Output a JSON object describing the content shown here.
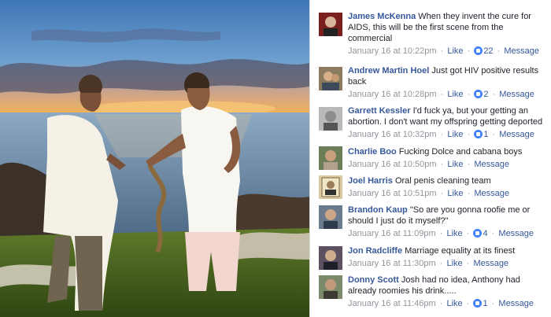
{
  "colors": {
    "link": "#365899",
    "meta": "#90949c",
    "text": "#1d2129",
    "like_badge": "#4080ff"
  },
  "photo": {
    "description_icon": "photo"
  },
  "comments": [
    {
      "name": "James McKenna",
      "text": "When they invent the cure for AIDS, this will be the first scene from the commercial",
      "time": "January 16 at 10:22pm",
      "like": "Like",
      "reactions": "22",
      "message": "Message",
      "avatar": "avatar-james"
    },
    {
      "name": "Andrew Martin Hoel",
      "text": "Just got HIV positive results back",
      "time": "January 16 at 10:28pm",
      "like": "Like",
      "reactions": "2",
      "message": "Message",
      "avatar": "avatar-andrew"
    },
    {
      "name": "Garrett Kessler",
      "text": "I'd fuck ya, but your getting an abortion. I don't want my offspring getting deported",
      "time": "January 16 at 10:32pm",
      "like": "Like",
      "reactions": "1",
      "message": "Message",
      "avatar": "avatar-garrett"
    },
    {
      "name": "Charlie Boo",
      "text": "Fucking Dolce and cabana boys",
      "time": "January 16 at 10:50pm",
      "like": "Like",
      "reactions": "",
      "message": "Message",
      "avatar": "avatar-charlie"
    },
    {
      "name": "Joel Harris",
      "text": "Oral penis cleaning team",
      "time": "January 16 at 10:51pm",
      "like": "Like",
      "reactions": "",
      "message": "Message",
      "avatar": "avatar-joel"
    },
    {
      "name": "Brandon Kaup",
      "text": "\"So are you gonna roofie me or should I just do it myself?\"",
      "time": "January 16 at 11:09pm",
      "like": "Like",
      "reactions": "4",
      "message": "Message",
      "avatar": "avatar-brandon"
    },
    {
      "name": "Jon Radcliffe",
      "text": "Marriage equality at its finest",
      "time": "January 16 at 11:30pm",
      "like": "Like",
      "reactions": "",
      "message": "Message",
      "avatar": "avatar-jon"
    },
    {
      "name": "Donny Scott",
      "text": "Josh had no idea, Anthony had already roomies his drink.....",
      "time": "January 16 at 11:46pm",
      "like": "Like",
      "reactions": "1",
      "message": "Message",
      "avatar": "avatar-donny"
    }
  ]
}
